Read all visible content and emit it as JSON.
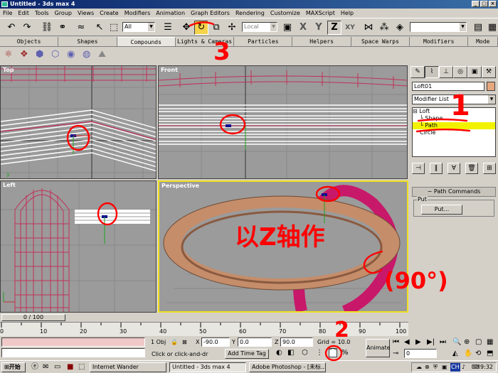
{
  "window": {
    "title": "Untitled - 3ds max 4",
    "buttons": [
      "_",
      "□",
      "×"
    ]
  },
  "menu": [
    "File",
    "Edit",
    "Tools",
    "Group",
    "Views",
    "Create",
    "Modifiers",
    "Animation",
    "Graph Editors",
    "Rendering",
    "Customize",
    "MAXScript",
    "Help"
  ],
  "toolbar": {
    "selection_filter": "All",
    "ref_coord": "Local",
    "axis_x": "X",
    "axis_y": "Y",
    "axis_z": "Z",
    "axis_xy": "XY"
  },
  "tabs": [
    "Objects",
    "Shapes",
    "Compounds",
    "Lights & Cameras",
    "Particles",
    "Helpers",
    "Space Warps",
    "Modifiers",
    "Mode"
  ],
  "active_tab": "Compounds",
  "viewports": {
    "top": "Top",
    "front": "Front",
    "left": "Left",
    "perspective": "Perspective"
  },
  "command_panel": {
    "object_name": "Loft01",
    "modifier_list": "Modifier List",
    "stack": [
      "Loft",
      "Shape",
      "Path",
      "Circle"
    ],
    "selected_stack": "Path",
    "rollout_title": "Path Commands",
    "group_label": "Put",
    "put_button": "Put..."
  },
  "time_slider": {
    "label": "0 / 100"
  },
  "ruler_ticks": [
    "0",
    "10",
    "20",
    "30",
    "40",
    "50",
    "60",
    "70",
    "80",
    "90",
    "100"
  ],
  "status": {
    "selected": "1 Obj",
    "x_label": "X",
    "x_value": "-90.0",
    "y_label": "Y",
    "y_value": "0.0",
    "z_label": "Z",
    "z_value": "90.0",
    "grid": "Grid = 10.0",
    "prompt": "Click or click-and-dr",
    "add_time_tag": "Add Time Tag",
    "animate": "Animate",
    "frame": "0"
  },
  "taskbar": {
    "start": "开始",
    "tasks": [
      "Internet Wander",
      "Untitled - 3ds max 4",
      "Adobe Photoshop - [未标..."
    ],
    "tray_lang": "CH",
    "clock": "9:32"
  },
  "annotations": {
    "mark_1": "1",
    "mark_2": "2",
    "mark_3": "3",
    "note": "以Z轴作",
    "note_angle": "(90°)"
  },
  "colors": {
    "highlight": "#f2f200",
    "viewport_bg": "#9b9b9b",
    "wire": "#b0305a",
    "annotation": "#ff0000",
    "title_bar": "#0a246a"
  }
}
